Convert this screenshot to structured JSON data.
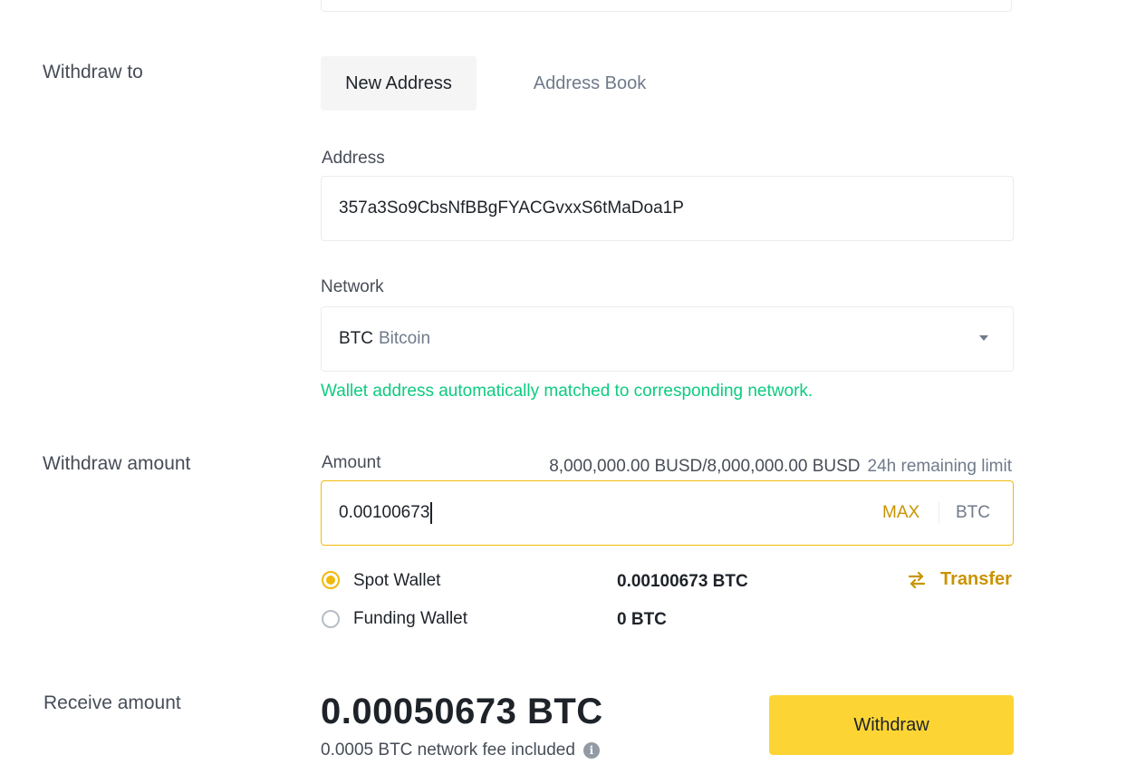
{
  "colors": {
    "accent": "#f0b90b",
    "accent_text": "#c99400",
    "success": "#0ecb81",
    "button_bg": "#fcd535"
  },
  "withdraw_to": {
    "label": "Withdraw to",
    "tabs": [
      {
        "label": "New Address",
        "active": true
      },
      {
        "label": "Address Book",
        "active": false
      }
    ]
  },
  "address": {
    "label": "Address",
    "value": "357a3So9CbsNfBBgFYACGvxxS6tMaDoa1P"
  },
  "network": {
    "label": "Network",
    "code": "BTC",
    "name": "Bitcoin",
    "dropdown_icon": "caret-down-icon",
    "match_message": "Wallet address automatically matched to corresponding network."
  },
  "withdraw_amount": {
    "label": "Withdraw amount",
    "field_label": "Amount",
    "limit_value": "8,000,000.00 BUSD/8,000,000.00 BUSD",
    "limit_label": "24h remaining limit",
    "value": "0.00100673",
    "max_label": "MAX",
    "unit": "BTC"
  },
  "wallets": [
    {
      "label": "Spot Wallet",
      "balance": "0.00100673 BTC",
      "selected": true
    },
    {
      "label": "Funding Wallet",
      "balance": "0 BTC",
      "selected": false
    }
  ],
  "transfer": {
    "label": "Transfer",
    "icon": "swap-arrows-icon"
  },
  "receive": {
    "label": "Receive amount",
    "amount": "0.00050673 BTC",
    "fee_note": "0.0005 BTC network fee included",
    "info_icon": "info-icon"
  },
  "withdraw_button": {
    "label": "Withdraw"
  }
}
